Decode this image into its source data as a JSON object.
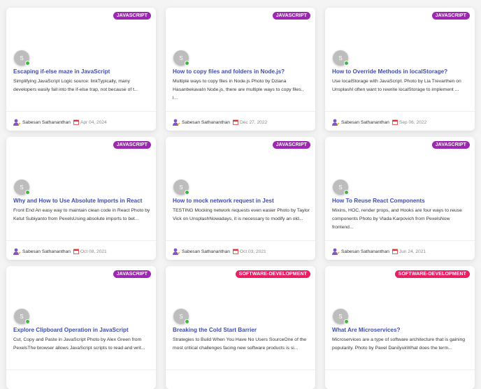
{
  "colors": {
    "javascript": "#9c27b0",
    "software-development": "#e91e63",
    "title": "#3f4db5"
  },
  "cards": [
    {
      "tag": "JAVASCRIPT",
      "avatar": "S",
      "title": "Escaping if-else maze in JavaScript",
      "desc": "Simplifying JavaScript Logic source: linkTypically, many developers easily fall into the if-else trap, not because of t...",
      "author": "Sabesan Sathananthan",
      "date": "Apr 04, 2024"
    },
    {
      "tag": "JAVASCRIPT",
      "avatar": "S",
      "title": "How to copy files and folders in Node.js?",
      "desc": "Multiple ways to copy files in Node.js Photo by Dziana HasanbekavaIn Node.js, there are multiple ways to copy files., l...",
      "author": "Sabesan Sathananthan",
      "date": "Dec 27, 2022"
    },
    {
      "tag": "JAVASCRIPT",
      "avatar": "S",
      "title": "How to Override Methods in localStorage?",
      "desc": "Use localStorage with JavaScript. Photo by Lia Trevarthen on UnsplashI often want to rewrite localStorage to implement ...",
      "author": "Sabesan Sathananthan",
      "date": "Sep 06, 2022"
    },
    {
      "tag": "JAVASCRIPT",
      "avatar": "S",
      "title": "Why and How to Use Absolute Imports in React",
      "desc": "Front End An easy way to maintain clean code in React Photo by Ketut Subiyanto from PexelsUsing absolute imports to bet...",
      "author": "Sabesan Sathananthan",
      "date": "Oct 08, 2021"
    },
    {
      "tag": "JAVASCRIPT",
      "avatar": "S",
      "title": "How to mock network request in Jest",
      "desc": "TESTING Mocking network requests even easier Photo by Taylor Vick on UnsplashNowadays, it is necessary to modify an old...",
      "author": "Sabesan Sathananthan",
      "date": "Oct 03, 2021"
    },
    {
      "tag": "JAVASCRIPT",
      "avatar": "S",
      "title": "How To Reuse React Components",
      "desc": "Mixins, HOC, render props, and Hooks are four ways to reuse components Photo by Vlada Karpovich from PexelsNow frontend...",
      "author": "Sabesan Sathananthan",
      "date": "Jun 24, 2021"
    },
    {
      "tag": "JAVASCRIPT",
      "avatar": "S",
      "title": "Explore Clipboard Operation in JavaScript",
      "desc": "Cut, Copy and Paste in JavaScript Photo by Alex Green from PexelsThe browser allows JavaScript scripts to read and writ...",
      "author": "",
      "date": ""
    },
    {
      "tag": "SOFTWARE-DEVELOPMENT",
      "avatar": "S",
      "title": "Breaking the Cold Start Barrier",
      "desc": "Strategies to Build When You Have No Users SourceOne of the most critical challenges facing new software products is si...",
      "author": "",
      "date": ""
    },
    {
      "tag": "SOFTWARE-DEVELOPMENT",
      "avatar": "S",
      "title": "What Are Microservices?",
      "desc": "Microservices are a type of software architecture that is gaining popularity. Photo by Pavel DaniIyukWhat does the term...",
      "author": "",
      "date": ""
    }
  ]
}
